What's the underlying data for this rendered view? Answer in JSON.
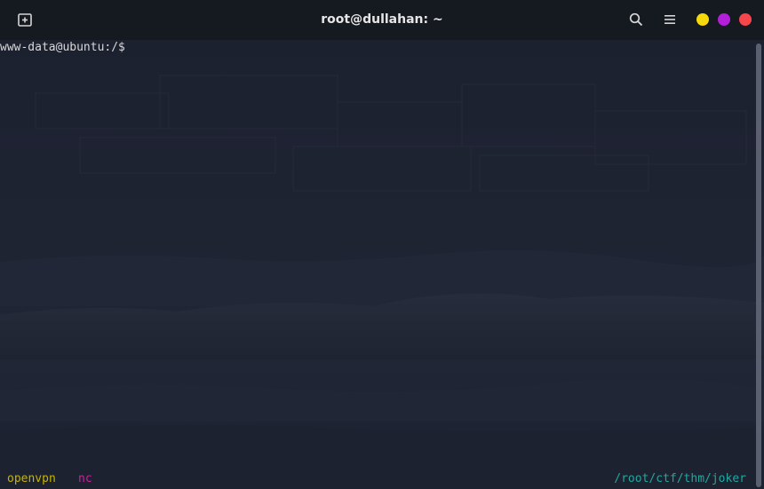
{
  "window": {
    "title": "root@dullahan: ~",
    "colors": {
      "minimize": "#f5d90a",
      "maximize": "#b21fd8",
      "close": "#f5474b"
    }
  },
  "titlebar": {
    "icons": [
      "new-tab-icon",
      "search-icon",
      "hamburger-menu-icon"
    ]
  },
  "terminal": {
    "prompt": "www-data@ubuntu:/$ "
  },
  "statusbar": {
    "left_items": [
      {
        "text": "openvpn",
        "color": "#c6b400"
      },
      {
        "text": "nc",
        "color": "#d01ea0"
      }
    ],
    "right_text": "/root/ctf/thm/joker",
    "right_color": "#1fa8a0"
  }
}
